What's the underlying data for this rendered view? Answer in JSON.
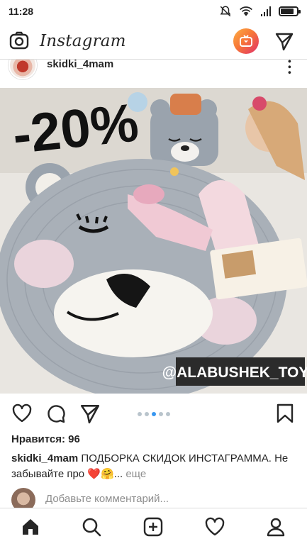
{
  "status_bar": {
    "time": "11:28"
  },
  "top_bar": {
    "app_name": "Instagram"
  },
  "post": {
    "username": "skidki_4mam",
    "image_texts": {
      "discount": "-20%",
      "watermark": "@ALABUSHEK_TOYS"
    },
    "carousel": {
      "total": 5,
      "active_index": 2
    },
    "likes_label": "Нравится: 96",
    "caption_user": "skidki_4mam",
    "caption_text": "ПОДБОРКА СКИДОК ИНСТАГРАММА. Не забывайте про ❤️🤗... ",
    "caption_more": "еще",
    "comment_placeholder": "Добавьте комментарий..."
  },
  "icons": {
    "top": [
      "camera-icon",
      "igtv-icon",
      "direct-icon"
    ],
    "actions": [
      "heart-icon",
      "comment-icon",
      "share-icon",
      "bookmark-icon"
    ],
    "bottom_nav": [
      "home-icon",
      "search-icon",
      "add-post-icon",
      "activity-icon",
      "profile-icon"
    ]
  },
  "colors": {
    "accent": "#3897f0",
    "igtv_gradient": [
      "#fcaf45",
      "#e1306c"
    ],
    "watermark_bg": "#2b2b2b"
  }
}
